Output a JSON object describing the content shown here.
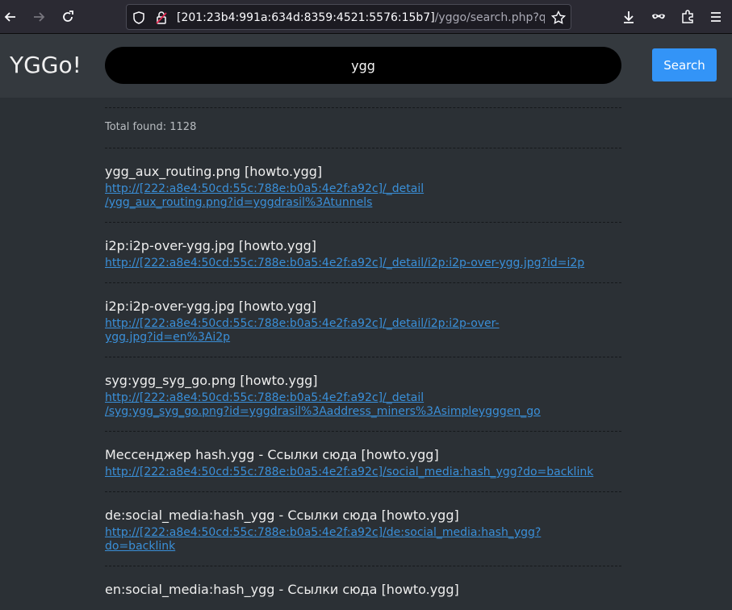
{
  "browser": {
    "url_main": "[201:23b4:991a:634d:8359:4521:5576:15b7]",
    "url_rest": "/yggo/search.php?q=y"
  },
  "site": {
    "logo": "YGGo!",
    "query": "ygg",
    "search_label": "Search",
    "total": "Total found: 1128"
  },
  "results": [
    {
      "title": "ygg_aux_routing.png [howto.ygg]",
      "url_lines": [
        "http://[222:a8e4:50cd:55c:788e:b0a5:4e2f:a92c]/_detail",
        "/ygg_aux_routing.png?id=yggdrasil%3Atunnels"
      ]
    },
    {
      "title": "i2p:i2p-over-ygg.jpg [howto.ygg]",
      "url_lines": [
        "http://[222:a8e4:50cd:55c:788e:b0a5:4e2f:a92c]/_detail/i2p:i2p-over-ygg.jpg?id=i2p"
      ]
    },
    {
      "title": "i2p:i2p-over-ygg.jpg [howto.ygg]",
      "url_lines": [
        "http://[222:a8e4:50cd:55c:788e:b0a5:4e2f:a92c]/_detail/i2p:i2p-over-",
        "ygg.jpg?id=en%3Ai2p"
      ]
    },
    {
      "title": "syg:ygg_syg_go.png [howto.ygg]",
      "url_lines": [
        "http://[222:a8e4:50cd:55c:788e:b0a5:4e2f:a92c]/_detail",
        "/syg:ygg_syg_go.png?id=yggdrasil%3Aaddress_miners%3Asimpleygggen_go"
      ]
    },
    {
      "title": "Мессенджер hash.ygg - Ссылки сюда [howto.ygg]",
      "url_lines": [
        "http://[222:a8e4:50cd:55c:788e:b0a5:4e2f:a92c]/social_media:hash_ygg?do=backlink"
      ]
    },
    {
      "title": "de:social_media:hash_ygg - Ссылки сюда [howto.ygg]",
      "url_lines": [
        "http://[222:a8e4:50cd:55c:788e:b0a5:4e2f:a92c]/de:social_media:hash_ygg?do=backlink"
      ]
    },
    {
      "title": "en:social_media:hash_ygg - Ссылки сюда [howto.ygg]",
      "url_lines": []
    }
  ]
}
